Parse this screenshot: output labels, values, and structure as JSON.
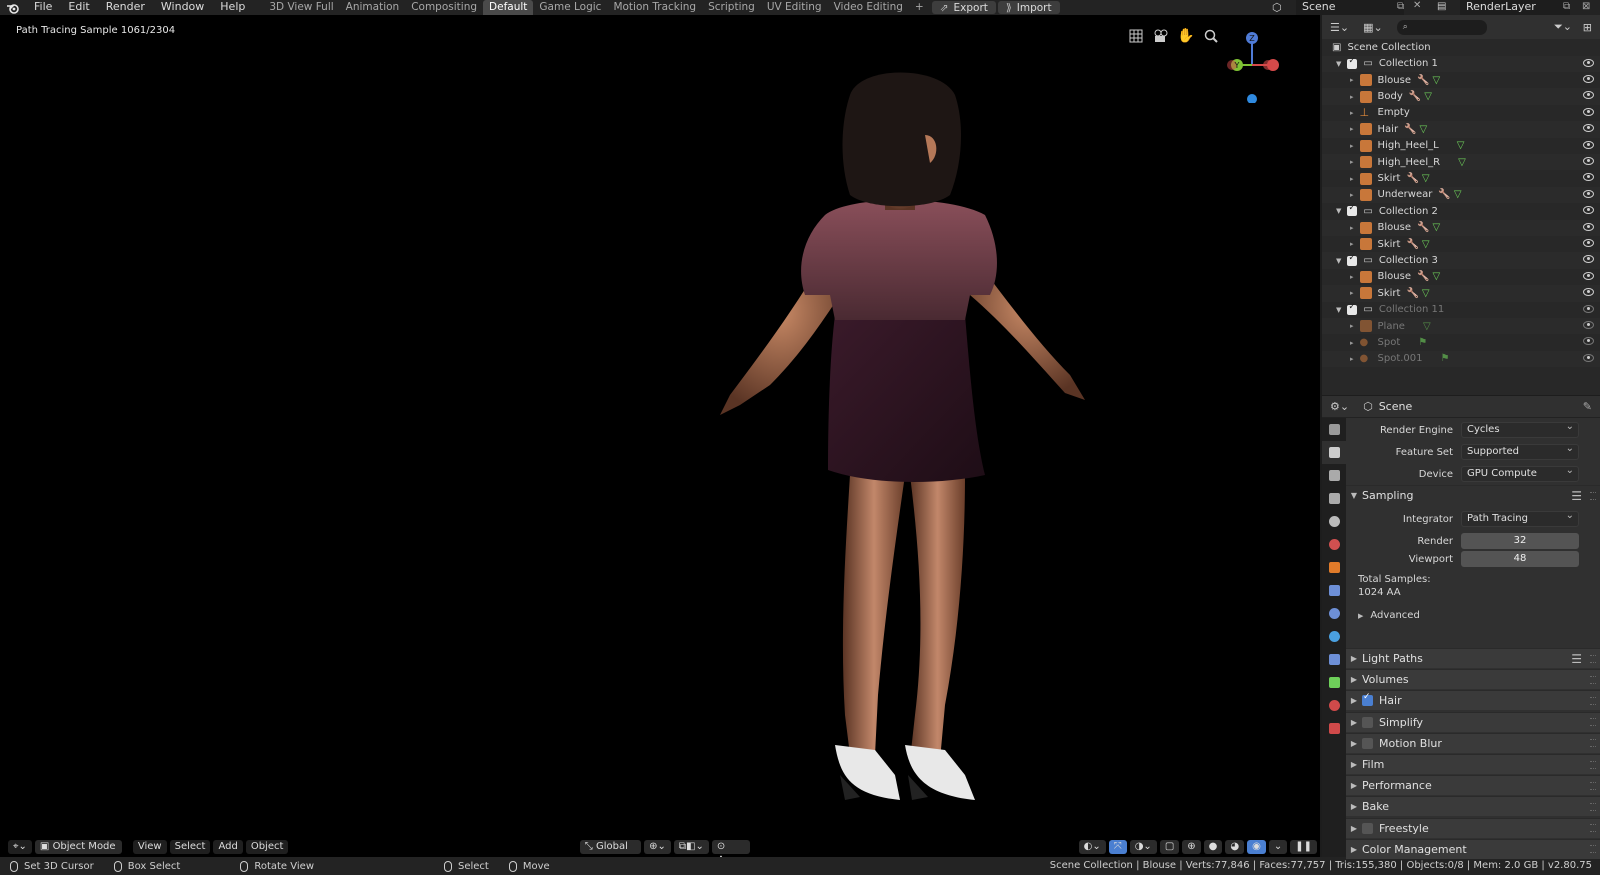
{
  "menu": [
    "File",
    "Edit",
    "Render",
    "Window",
    "Help"
  ],
  "workspaces": [
    "3D View Full",
    "Animation",
    "Compositing",
    "Default",
    "Game Logic",
    "Motion Tracking",
    "Scripting",
    "UV Editing",
    "Video Editing"
  ],
  "active_workspace": "Default",
  "add_workspace": "+",
  "buttons": {
    "export": "Export",
    "import": "Import"
  },
  "scene_name": "Scene",
  "render_layer": "RenderLayer",
  "viewport": {
    "render_info": "Path Tracing Sample 1061/2304",
    "mode": "Object Mode",
    "menus": [
      "View",
      "Select",
      "Add",
      "Object"
    ],
    "orientation": "Global",
    "gizmo": {
      "z": "Z",
      "y": "Y"
    }
  },
  "outliner": {
    "scene_collection": "Scene Collection",
    "rows": [
      {
        "label": "Collection 1",
        "type": "collection",
        "indent": 1
      },
      {
        "label": "Blouse",
        "type": "mesh",
        "indent": 2,
        "mods": true
      },
      {
        "label": "Body",
        "type": "mesh",
        "indent": 2,
        "mods": true
      },
      {
        "label": "Empty",
        "type": "empty",
        "indent": 2,
        "mods": false
      },
      {
        "label": "Hair",
        "type": "mesh",
        "indent": 2,
        "mods": true
      },
      {
        "label": "High_Heel_L",
        "type": "mesh",
        "indent": 2,
        "mods": "data"
      },
      {
        "label": "High_Heel_R",
        "type": "mesh",
        "indent": 2,
        "mods": "data"
      },
      {
        "label": "Skirt",
        "type": "mesh",
        "indent": 2,
        "mods": true
      },
      {
        "label": "Underwear",
        "type": "mesh",
        "indent": 2,
        "mods": true
      },
      {
        "label": "Collection 2",
        "type": "collection",
        "indent": 1
      },
      {
        "label": "Blouse",
        "type": "mesh",
        "indent": 2,
        "mods": true
      },
      {
        "label": "Skirt",
        "type": "mesh",
        "indent": 2,
        "mods": true
      },
      {
        "label": "Collection 3",
        "type": "collection",
        "indent": 1
      },
      {
        "label": "Blouse",
        "type": "mesh",
        "indent": 2,
        "mods": true
      },
      {
        "label": "Skirt",
        "type": "mesh",
        "indent": 2,
        "mods": true
      },
      {
        "label": "Collection 11",
        "type": "collection",
        "indent": 1,
        "dim": true
      },
      {
        "label": "Plane",
        "type": "mesh",
        "indent": 2,
        "mods": "data",
        "dim": true
      },
      {
        "label": "Spot",
        "type": "light",
        "indent": 2,
        "mods": "light",
        "dim": true
      },
      {
        "label": "Spot.001",
        "type": "light",
        "indent": 2,
        "mods": "light",
        "dim": true
      }
    ]
  },
  "properties": {
    "context": "Scene",
    "render_engine_label": "Render Engine",
    "render_engine": "Cycles",
    "feature_set_label": "Feature Set",
    "feature_set": "Supported",
    "device_label": "Device",
    "device": "GPU Compute",
    "sampling": "Sampling",
    "integrator_label": "Integrator",
    "integrator": "Path Tracing",
    "render_label": "Render",
    "render_samples": "32",
    "viewport_label": "Viewport",
    "viewport_samples": "48",
    "total_samples_label": "Total Samples:",
    "total_samples": "1024 AA",
    "advanced": "Advanced",
    "panels": [
      {
        "label": "Light Paths",
        "checkbox": null,
        "list": true
      },
      {
        "label": "Volumes",
        "checkbox": null
      },
      {
        "label": "Hair",
        "checkbox": true
      },
      {
        "label": "Simplify",
        "checkbox": false
      },
      {
        "label": "Motion Blur",
        "checkbox": false
      },
      {
        "label": "Film",
        "checkbox": null
      },
      {
        "label": "Performance",
        "checkbox": null
      },
      {
        "label": "Bake",
        "checkbox": null
      },
      {
        "label": "Freestyle",
        "checkbox": false
      },
      {
        "label": "Color Management",
        "checkbox": null
      }
    ]
  },
  "statusbar": {
    "left": [
      {
        "label": "Set 3D Cursor"
      },
      {
        "label": "Box Select"
      },
      {
        "label": "Rotate View"
      },
      {
        "label": "Select"
      },
      {
        "label": "Move"
      }
    ],
    "stats": "Scene Collection | Blouse | Verts:77,846 | Faces:77,757 | Tris:155,380 | Objects:0/8 | Mem: 2.0 GB | v2.80.75"
  },
  "colors": {
    "accent": "#4a7fd1",
    "mesh": "#c8773a",
    "modifier": "#7aa0e0",
    "data": "#6ed05a"
  }
}
